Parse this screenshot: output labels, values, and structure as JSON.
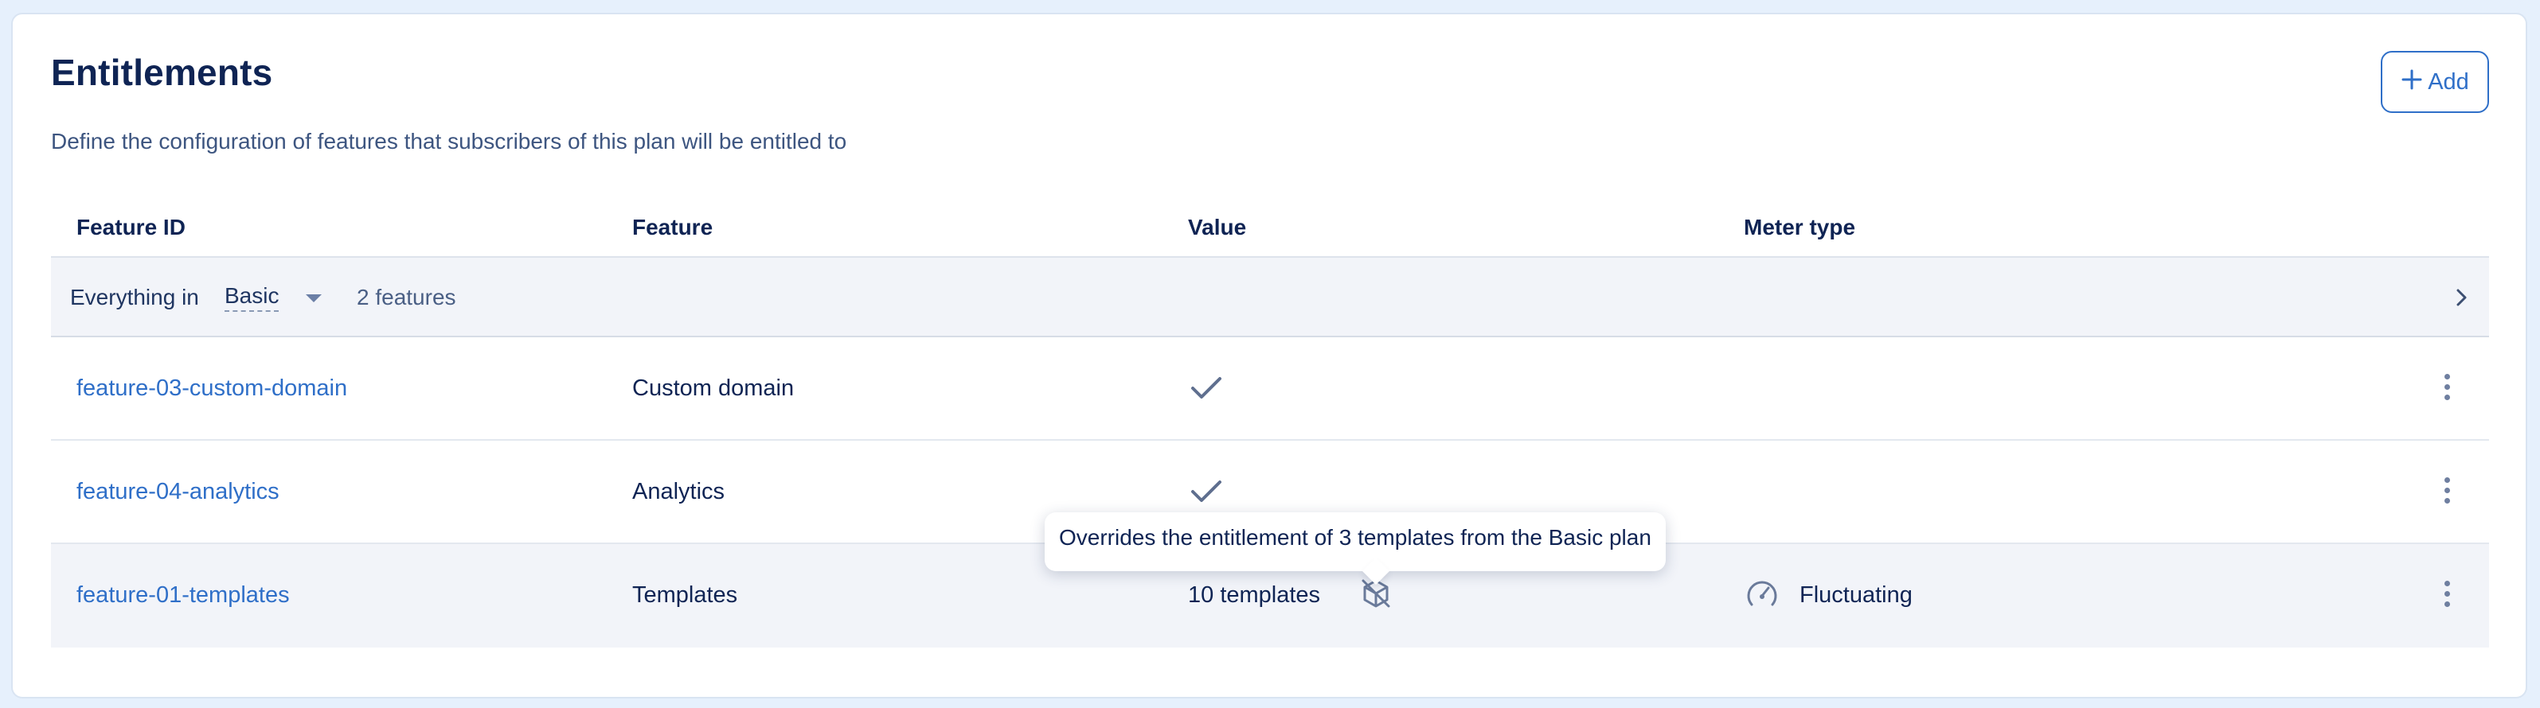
{
  "section": {
    "title": "Entitlements",
    "subtitle": "Define the configuration of features that subscribers of this plan will be entitled to",
    "add_label": "Add"
  },
  "table": {
    "columns": [
      "Feature ID",
      "Feature",
      "Value",
      "Meter type"
    ],
    "group": {
      "prefix": "Everything in",
      "plan": "Basic",
      "count": "2 features"
    },
    "rows": [
      {
        "feature_id": "feature-03-custom-domain",
        "feature": "Custom domain",
        "value": "",
        "value_icon": "check-icon",
        "meter_type": ""
      },
      {
        "feature_id": "feature-04-analytics",
        "feature": "Analytics",
        "value": "",
        "value_icon": "check-icon",
        "meter_type": ""
      },
      {
        "feature_id": "feature-01-templates",
        "feature": "Templates",
        "value": "10 templates",
        "value_icon": "override-cube-icon",
        "meter_type": "Fluctuating",
        "meter_icon": "gauge-icon"
      }
    ]
  },
  "tooltip": {
    "text": "Overrides the entitlement of 3 templates from the Basic plan"
  },
  "colors": {
    "accent": "#2f6fc8",
    "heading": "#0f2454",
    "row_highlight": "#f2f4f9",
    "page_bg": "#e6f0fc"
  }
}
